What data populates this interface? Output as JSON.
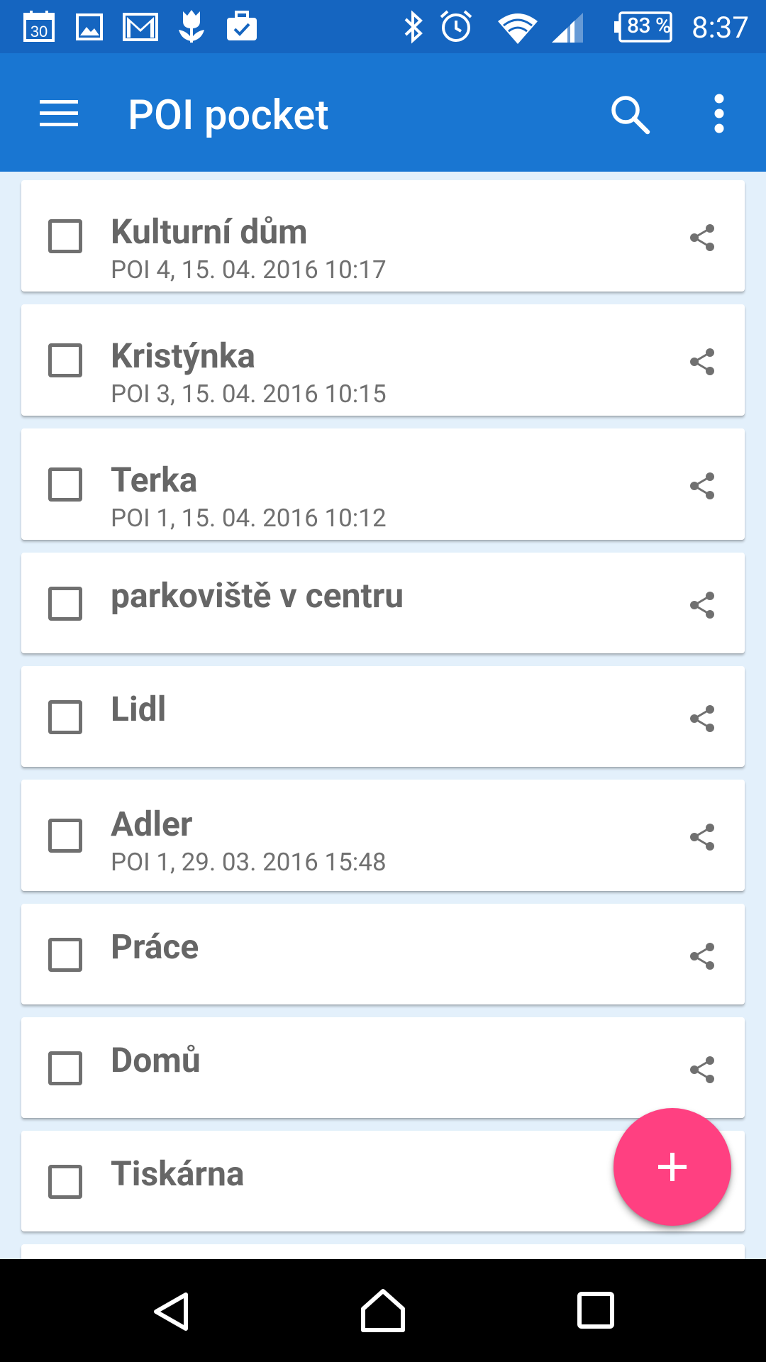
{
  "status_bar": {
    "calendar_day": "30",
    "battery": "83 %",
    "time": "8:37",
    "icons": [
      "calendar-icon",
      "gallery-icon",
      "gmail-icon",
      "tulip-icon",
      "briefcase-check-icon",
      "bluetooth-icon",
      "alarm-icon",
      "wifi-icon",
      "signal-icon",
      "battery-icon"
    ]
  },
  "app_bar": {
    "title": "POI pocket",
    "icons": [
      "menu-icon",
      "search-icon",
      "more-vert-icon"
    ]
  },
  "items": [
    {
      "name": "Kulturní dům",
      "sub": "POI 4, 15. 04. 2016 10:17"
    },
    {
      "name": "Kristýnka",
      "sub": "POI 3, 15. 04. 2016 10:15"
    },
    {
      "name": "Terka",
      "sub": "POI 1, 15. 04. 2016 10:12"
    },
    {
      "name": "parkoviště v centru",
      "sub": ""
    },
    {
      "name": "Lidl",
      "sub": ""
    },
    {
      "name": "Adler",
      "sub": "POI 1, 29. 03. 2016 15:48"
    },
    {
      "name": "Práce",
      "sub": ""
    },
    {
      "name": "Domů",
      "sub": ""
    },
    {
      "name": "Tiskárna",
      "sub": ""
    }
  ],
  "fab": {
    "label": "+",
    "color": "#ff4081"
  },
  "colors": {
    "status_bar": "#1565c0",
    "app_bar": "#1976d2",
    "background": "#e3f0fb"
  }
}
